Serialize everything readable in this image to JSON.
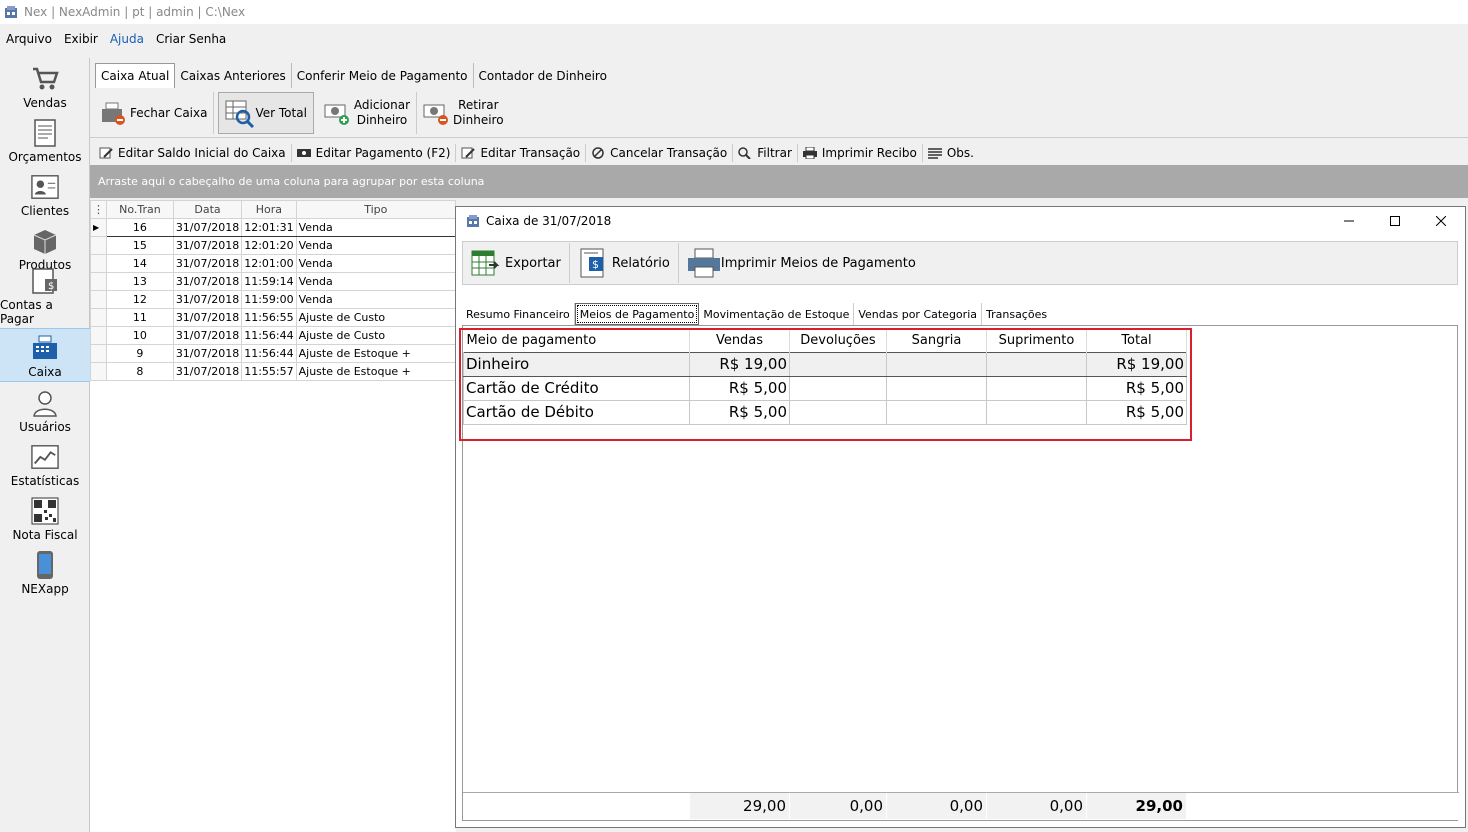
{
  "window": {
    "title": "Nex | NexAdmin | pt | admin | C:\\Nex"
  },
  "menu": [
    "Arquivo",
    "Exibir",
    "Ajuda",
    "Criar Senha"
  ],
  "sidebar": [
    {
      "label": "Vendas",
      "icon": "cart-icon"
    },
    {
      "label": "Orçamentos",
      "icon": "document-icon"
    },
    {
      "label": "Clientes",
      "icon": "contact-card-icon"
    },
    {
      "label": "Produtos",
      "icon": "boxes-icon"
    },
    {
      "label": "Contas a Pagar",
      "icon": "bill-icon"
    },
    {
      "label": "Caixa",
      "icon": "cash-register-icon"
    },
    {
      "label": "Usuários",
      "icon": "user-icon"
    },
    {
      "label": "Estatísticas",
      "icon": "chart-icon"
    },
    {
      "label": "Nota Fiscal",
      "icon": "qrcode-icon"
    },
    {
      "label": "NEXapp",
      "icon": "phone-icon"
    }
  ],
  "tabs": [
    "Caixa Atual",
    "Caixas Anteriores",
    "Conferir Meio de Pagamento",
    "Contador de Dinheiro"
  ],
  "toolbar1": {
    "fechar": "Fechar Caixa",
    "ver_total": "Ver Total",
    "adicionar_1": "Adicionar",
    "adicionar_2": "Dinheiro",
    "retirar_1": "Retirar",
    "retirar_2": "Dinheiro"
  },
  "toolbar2": [
    "Editar Saldo Inicial do Caixa",
    "Editar Pagamento (F2)",
    "Editar Transação",
    "Cancelar Transação",
    "Filtrar",
    "Imprimir Recibo",
    "Obs."
  ],
  "groupbar": "Arraste aqui o cabeçalho de uma coluna para agrupar por esta coluna",
  "grid": {
    "headers": [
      "No.Tran",
      "Data",
      "Hora",
      "Tipo"
    ],
    "rows": [
      [
        "16",
        "31/07/2018",
        "12:01:31",
        "Venda"
      ],
      [
        "15",
        "31/07/2018",
        "12:01:20",
        "Venda"
      ],
      [
        "14",
        "31/07/2018",
        "12:01:00",
        "Venda"
      ],
      [
        "13",
        "31/07/2018",
        "11:59:14",
        "Venda"
      ],
      [
        "12",
        "31/07/2018",
        "11:59:00",
        "Venda"
      ],
      [
        "11",
        "31/07/2018",
        "11:56:55",
        "Ajuste de Custo"
      ],
      [
        "10",
        "31/07/2018",
        "11:56:44",
        "Ajuste de Custo"
      ],
      [
        "9",
        "31/07/2018",
        "11:56:44",
        "Ajuste de Estoque +"
      ],
      [
        "8",
        "31/07/2018",
        "11:55:57",
        "Ajuste de Estoque +"
      ]
    ]
  },
  "dialog": {
    "title": "Caixa de 31/07/2018",
    "toolbar": [
      "Exportar",
      "Relatório",
      "Imprimir Meios de Pagamento"
    ],
    "tabs": [
      "Resumo Financeiro",
      "Meios de Pagamento",
      "Movimentação de Estoque",
      "Vendas por Categoria",
      "Transações"
    ],
    "table": {
      "headers": [
        "Meio de pagamento",
        "Vendas",
        "Devoluções",
        "Sangria",
        "Suprimento",
        "Total"
      ],
      "rows": [
        [
          "Dinheiro",
          "R$ 19,00",
          "",
          "",
          "",
          "R$ 19,00"
        ],
        [
          "Cartão de Crédito",
          "R$ 5,00",
          "",
          "",
          "",
          "R$ 5,00"
        ],
        [
          "Cartão de Débito",
          "R$ 5,00",
          "",
          "",
          "",
          "R$ 5,00"
        ]
      ]
    },
    "totals": [
      "29,00",
      "0,00",
      "0,00",
      "0,00",
      "29,00"
    ]
  }
}
